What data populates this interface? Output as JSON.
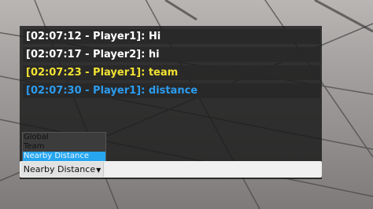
{
  "chat": {
    "messages": [
      {
        "text": "[02:07:12 - Player1]: Hi",
        "color": "#ffffff"
      },
      {
        "text": "[02:07:17 - Player2]: hi",
        "color": "#ffffff"
      },
      {
        "text": "[02:07:23 - Player1]: team",
        "color": "#f2e232"
      },
      {
        "text": "[02:07:30 - Player1]: distance",
        "color": "#2b9cf0"
      }
    ],
    "channel_options": [
      "Global",
      "Team",
      "Nearby Distance"
    ],
    "selected_channel": "Nearby Distance",
    "input_value": ""
  }
}
